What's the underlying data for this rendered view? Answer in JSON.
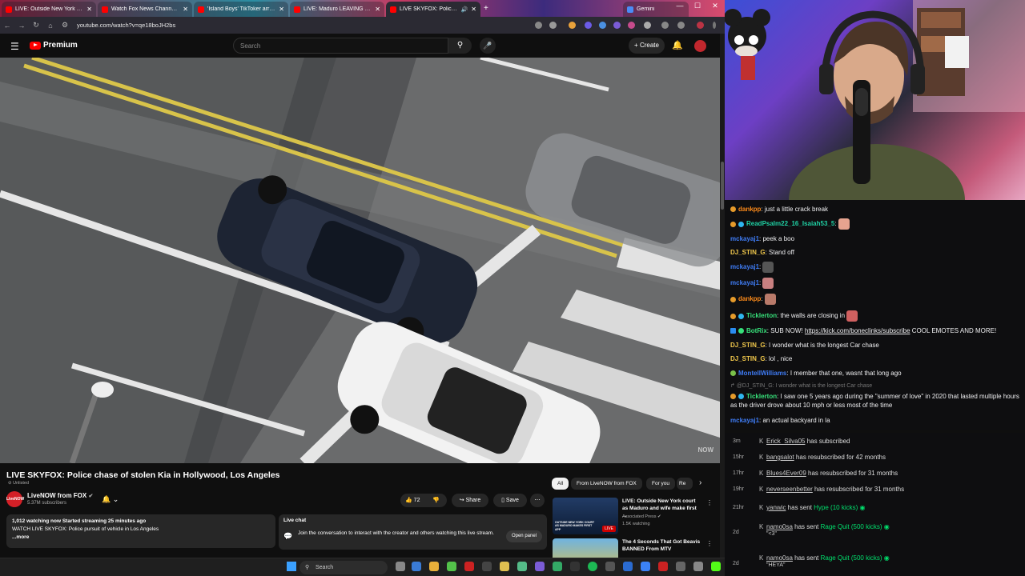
{
  "browser": {
    "tabs": [
      {
        "title": "LIVE: Outside New York court a",
        "active": false
      },
      {
        "title": "Watch Fox News Channel O",
        "active": false
      },
      {
        "title": "'Island Boys' TikToker arrested",
        "active": false
      },
      {
        "title": "LIVE: Maduro LEAVING COURT",
        "active": false
      },
      {
        "title": "LIVE SKYFOX: Police chase o",
        "active": true
      },
      {
        "title": "Gemini",
        "active": false
      }
    ],
    "new_tab": "+",
    "url": "youtube.com/watch?v=qe18boJH2bs"
  },
  "youtube": {
    "brand": "Premium",
    "search_placeholder": "Search",
    "create_label": "Create",
    "watermark": "NOW",
    "video_title": "LIVE SKYFOX: Police chase of stolen Kia in Hollywood, Los Angeles",
    "unlisted": "Unlisted",
    "channel_avatar_text": "LiveNOW",
    "channel_name": "LiveNOW from FOX",
    "subscribers": "5.37M subscribers",
    "likes": "72",
    "share_label": "Share",
    "save_label": "Save",
    "description_line1": "1,012 watching now  Started streaming 25 minutes ago",
    "description_line2": "WATCH LIVE SKYFOX: Police pursuit of vehicle in Los Angeles",
    "description_more": "...more",
    "livechat_title": "Live chat",
    "livechat_text": "Join the conversation to interact with the creator and others watching this live stream.",
    "open_panel": "Open panel",
    "chips": [
      "All",
      "From LiveNOW from FOX",
      "For you",
      "Re"
    ],
    "recommendations": [
      {
        "title": "LIVE: Outside New York court as Maduro and wife make first ...",
        "channel": "Associated Press",
        "meta": "1.5K watching",
        "badge": "LIVE",
        "thumb_text": "OUTSIDE NEW YORK COURT AS MADURO MAKES FIRST APP"
      },
      {
        "title": "The 4 Seconds That Got Beavis BANNED From MTV",
        "channel": "",
        "meta": "",
        "badge": "",
        "thumb_text": ""
      }
    ]
  },
  "chat": {
    "messages": [
      {
        "user": "dankpp",
        "color": "#ff8c1a",
        "text": "just a little crack break"
      },
      {
        "user": "ReadPsalm22_16_Isaiah53_5",
        "color": "#1fd1a4",
        "text": ""
      },
      {
        "user": "mckayaj1",
        "color": "#3f7cf5",
        "text": "peek a boo"
      },
      {
        "user": "DJ_STIN_G",
        "color": "#f2c94c",
        "text": "Stand off"
      },
      {
        "user": "mckayaj1",
        "color": "#3f7cf5",
        "text": ""
      },
      {
        "user": "mckayaj1",
        "color": "#3f7cf5",
        "text": ""
      },
      {
        "user": "dankpp",
        "color": "#ff8c1a",
        "text": ""
      },
      {
        "user": "Ticklerton",
        "color": "#37e07a",
        "text": "the walls are closing in"
      },
      {
        "user": "BotRix",
        "color": "#37e07a",
        "text": "SUB NOW! ",
        "link": "https://kick.com/boneclinks/subscribe",
        "after": " COOL EMOTES AND MORE!"
      },
      {
        "user": "DJ_STIN_G",
        "color": "#f2c94c",
        "text": "I wonder what is the longest Car chase"
      },
      {
        "user": "DJ_STIN_G",
        "color": "#f2c94c",
        "text": "lol , nice"
      },
      {
        "user": "MontellWilliams",
        "color": "#3f7cf5",
        "text": "I member that one, wasnt that long ago"
      },
      {
        "user": "",
        "color": "#777",
        "text": "@DJ_STIN_G: I wonder what is the longest Car chase"
      },
      {
        "user": "Ticklerton",
        "color": "#37e07a",
        "text": "I saw one 5 years ago during the \"summer of love\" in 2020 that lasted multiple hours as the driver drove about 10 mph or less most of the time"
      },
      {
        "user": "mckayaj1",
        "color": "#3f7cf5",
        "text": "an actual backyard in la"
      }
    ]
  },
  "alerts": [
    {
      "time": "3m",
      "user": "Erick_Silva05",
      "text": " has subscribed",
      "extra": "",
      "sub": ""
    },
    {
      "time": "15hr",
      "user": "bangsalot",
      "text": " has resubscribed for 42 months",
      "extra": "",
      "sub": ""
    },
    {
      "time": "17hr",
      "user": "Blues4Ever09",
      "text": " has resubscribed for 31 months",
      "extra": "",
      "sub": ""
    },
    {
      "time": "19hr",
      "user": "neverseenbetter",
      "text": " has resubscribed for 31 months",
      "extra": "",
      "sub": ""
    },
    {
      "time": "21hr",
      "user": "yanwic",
      "text": " has sent ",
      "extra": "Hype (10 kicks)",
      "sub": ""
    },
    {
      "time": "2d",
      "user": "namo0sa",
      "text": " has sent ",
      "extra": "Rage Quit (500 kicks)",
      "sub": "\"<3\""
    },
    {
      "time": "2d",
      "user": "namo0sa",
      "text": " has sent ",
      "extra": "Rage Quit (500 kicks)",
      "sub": "\"HEYA\""
    }
  ],
  "taskbar": {
    "search_placeholder": "Search"
  }
}
